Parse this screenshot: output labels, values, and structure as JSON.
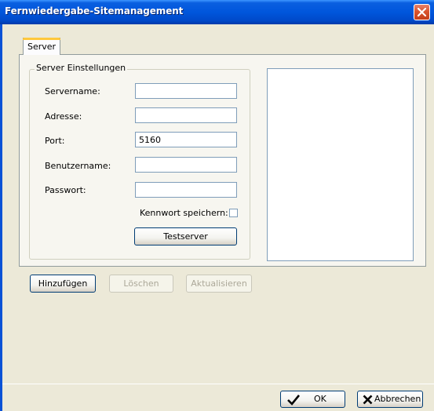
{
  "window": {
    "title": "Fernwiedergabe-Sitemanagement"
  },
  "tabs": [
    {
      "label": "Server"
    }
  ],
  "server_settings": {
    "group_label": "Server Einstellungen",
    "fields": {
      "servername": {
        "label": "Servername:",
        "value": ""
      },
      "adresse": {
        "label": "Adresse:",
        "value": ""
      },
      "port": {
        "label": "Port:",
        "value": "5160"
      },
      "benutzername": {
        "label": "Benutzername:",
        "value": ""
      },
      "passwort": {
        "label": "Passwort:",
        "value": ""
      }
    },
    "save_password_label": "Kennwort speichern:",
    "save_password_checked": false,
    "test_button": "Testserver"
  },
  "server_list": {
    "items": []
  },
  "actions": {
    "add": "Hinzufügen",
    "delete": "Löschen",
    "update": "Aktualisieren"
  },
  "footer": {
    "ok": "OK",
    "cancel": "Abbrechen"
  },
  "colors": {
    "titlebar": "#0055e5",
    "close_button": "#d9542e",
    "tab_highlight": "#ffc83c",
    "dialog_bg": "#ece9d8"
  }
}
